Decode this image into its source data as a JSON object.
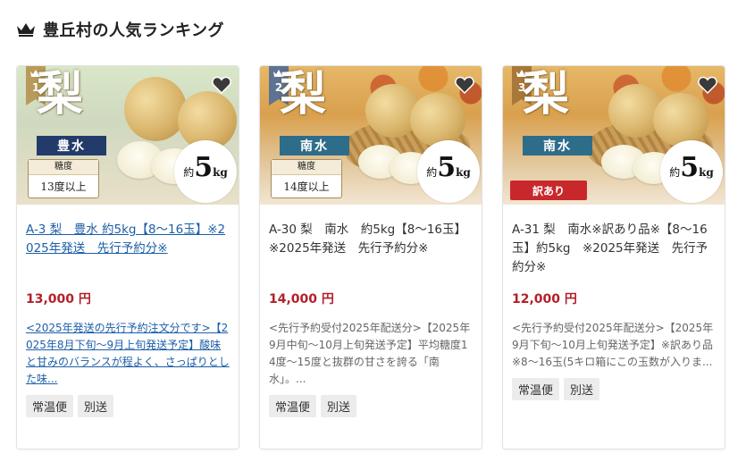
{
  "section_title": "豊丘村の人気ランキング",
  "icons": {
    "heading": "crown-icon",
    "favorite": "heart-icon"
  },
  "colors": {
    "price": "#b3202a",
    "link": "#1d5fa8",
    "rank1": "#b89a5a",
    "rank2": "#5e7391",
    "rank3": "#a8783a"
  },
  "cards": [
    {
      "rank": "1",
      "image": {
        "kanji": "梨",
        "variety": "豊水",
        "sugar_label": "糖度",
        "sugar_value": "13度以上",
        "weight_prefix": "約",
        "weight_num": "5",
        "weight_unit": "kg"
      },
      "title": "A-3 梨　豊水 約5kg【8～16玉】※2025年発送　先行予約分※",
      "price": "13,000 円",
      "description": "<2025年発送の先行予約注文分です>【2025年8月下旬～9月上旬発送予定】酸味と甘みのバランスが程よく、さっぱりとした味...",
      "tags": [
        "常温便",
        "別送"
      ]
    },
    {
      "rank": "2",
      "image": {
        "kanji": "梨",
        "variety": "南水",
        "sugar_label": "糖度",
        "sugar_value": "14度以上",
        "weight_prefix": "約",
        "weight_num": "5",
        "weight_unit": "kg"
      },
      "title": "A-30 梨　南水　約5kg【8～16玉】※2025年発送　先行予約分※",
      "price": "14,000 円",
      "description": "<先行予約受付2025年配送分>【2025年9月中旬～10月上旬発送予定】平均糖度14度～15度と抜群の甘さを誇る「南水」。...",
      "tags": [
        "常温便",
        "別送"
      ]
    },
    {
      "rank": "3",
      "image": {
        "kanji": "梨",
        "variety": "南水",
        "badge": "訳あり",
        "weight_prefix": "約",
        "weight_num": "5",
        "weight_unit": "kg"
      },
      "title": "A-31 梨　南水※訳あり品※【8～16玉】約5kg　※2025年発送　先行予約分※",
      "price": "12,000 円",
      "description": "<先行予約受付2025年配送分>【2025年9月下旬～10月上旬発送予定】※訳あり品※8～16玉(5キロ箱にこの玉数が入りま...",
      "tags": [
        "常温便",
        "別送"
      ]
    }
  ]
}
